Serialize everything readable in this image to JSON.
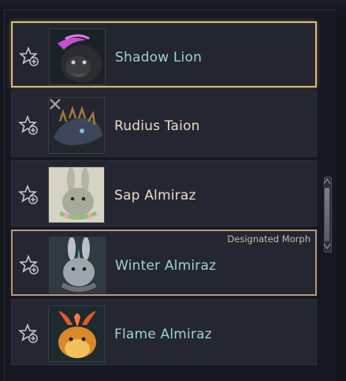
{
  "morph_list": {
    "items": [
      {
        "name": "Shadow Lion",
        "name_color": "teal",
        "state": "selected",
        "badge": "",
        "portrait": "shadow-lion"
      },
      {
        "name": "Rudius Taion",
        "name_color": "cream",
        "state": "normal",
        "badge": "",
        "portrait": "rudius-taion"
      },
      {
        "name": "Sap Almiraz",
        "name_color": "cream",
        "state": "normal",
        "badge": "",
        "portrait": "sap-almiraz"
      },
      {
        "name": "Winter Almiraz",
        "name_color": "teal",
        "state": "designated",
        "badge": "Designated Morph",
        "portrait": "winter-almiraz"
      },
      {
        "name": "Flame Almiraz",
        "name_color": "teal",
        "state": "normal",
        "badge": "",
        "portrait": "flame-almiraz"
      }
    ]
  },
  "icons": {
    "favorite": "star-plus-icon",
    "scrollbar": "scrollbar"
  },
  "colors": {
    "selected_border": "#d8b879",
    "designated_border": "#b79a74",
    "teal_text": "#9fd2cc",
    "cream_text": "#eadcc4"
  }
}
